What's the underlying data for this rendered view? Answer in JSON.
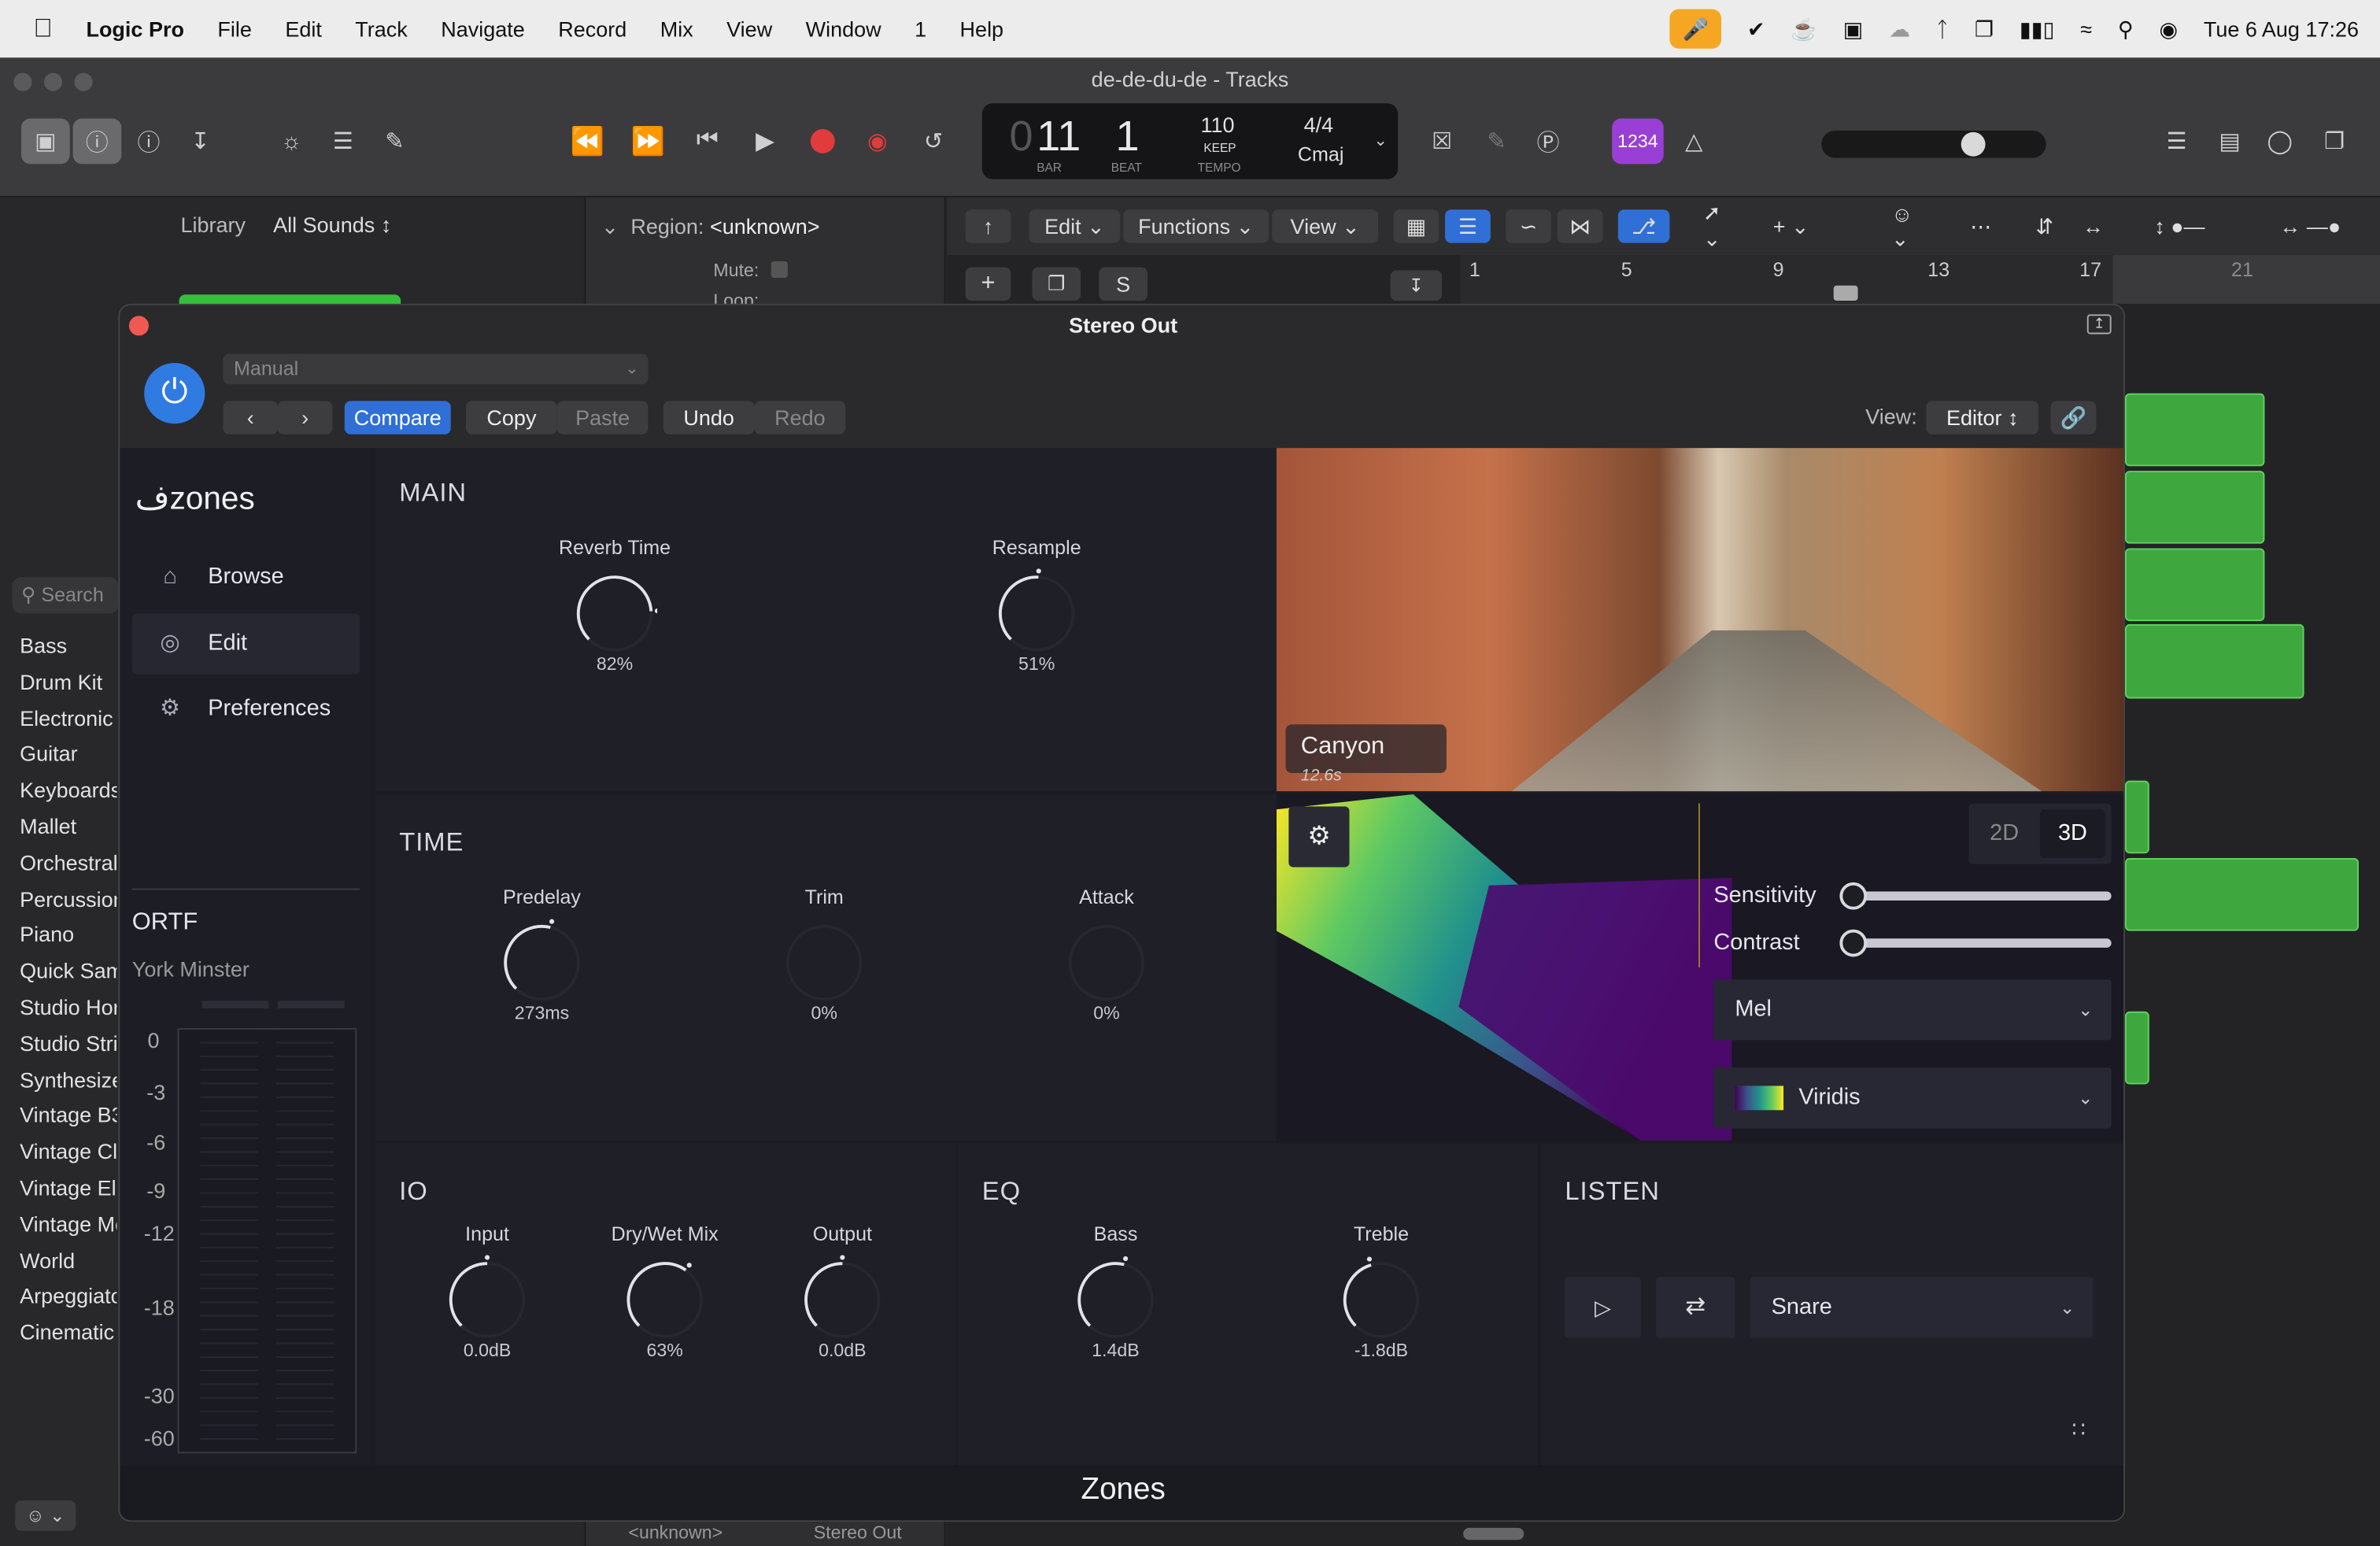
{
  "menubar": {
    "app": "Logic Pro",
    "items": [
      "File",
      "Edit",
      "Track",
      "Navigate",
      "Record",
      "Mix",
      "View",
      "Window",
      "1",
      "Help"
    ],
    "datetime": "Tue 6 Aug  17:26"
  },
  "window": {
    "title": "de-de-du-de - Tracks"
  },
  "lcd": {
    "bar": "11",
    "bar_prefix": "0",
    "bar_label": "BAR",
    "beat": "1",
    "beat_label": "BEAT",
    "tempo": "110",
    "tempo_mode": "KEEP",
    "tempo_label": "TEMPO",
    "signature": "4/4",
    "key": "Cmaj"
  },
  "count_in": "1234",
  "library": {
    "title": "Library",
    "sounds_dropdown": "All Sounds",
    "search_placeholder": "Search",
    "categories": [
      "Bass",
      "Drum Kit",
      "Electronic",
      "Guitar",
      "Keyboards",
      "Mallet",
      "Orchestral",
      "Percussion",
      "Piano",
      "Quick Sampler",
      "Studio Horns",
      "Studio Strings",
      "Synthesizer",
      "Vintage B3",
      "Vintage Clav",
      "Vintage Electric Piano",
      "Vintage Mellotron",
      "World",
      "Arpeggiator",
      "Cinematic"
    ]
  },
  "region": {
    "label": "Region:",
    "name": "<unknown>",
    "mute_label": "Mute:",
    "loop_label": "Loop:"
  },
  "tracks_toolbar": {
    "edit": "Edit",
    "functions": "Functions",
    "view": "View",
    "solo": "S"
  },
  "ruler": {
    "marks": [
      "1",
      "5",
      "9",
      "13",
      "17",
      "21"
    ]
  },
  "bottom_strip": {
    "left": "<unknown>",
    "right": "Stereo Out"
  },
  "plugin": {
    "title": "Stereo Out",
    "preset": "Manual",
    "compare": "Compare",
    "copy": "Copy",
    "paste": "Paste",
    "undo": "Undo",
    "redo": "Redo",
    "view_label": "View:",
    "view_value": "Editor",
    "footer": "Zones",
    "brand": "zones",
    "nav": [
      {
        "label": "Browse",
        "icon": "home-icon"
      },
      {
        "label": "Edit",
        "icon": "target-icon"
      },
      {
        "label": "Preferences",
        "icon": "gear-icon"
      }
    ],
    "ir": {
      "format": "ORTF",
      "name": "York Minster"
    },
    "meter_scale": [
      "0",
      "-3",
      "-6",
      "-9",
      "-12",
      "-18",
      "-30",
      "-60"
    ],
    "main": {
      "title": "MAIN",
      "reverb_time": {
        "label": "Reverb Time",
        "value": "82%",
        "level": 0.82
      },
      "resample": {
        "label": "Resample",
        "value": "51%",
        "level": 0.51
      }
    },
    "time": {
      "title": "TIME",
      "predelay": {
        "label": "Predelay",
        "value": "273ms",
        "level": 0.55
      },
      "trim": {
        "label": "Trim",
        "value": "0%",
        "level": 0
      },
      "attack": {
        "label": "Attack",
        "value": "0%",
        "level": 0
      }
    },
    "io": {
      "title": "IO",
      "input": {
        "label": "Input",
        "value": "0.0dB",
        "level": 0.5
      },
      "drywet": {
        "label": "Dry/Wet Mix",
        "value": "63%",
        "level": 0.63
      },
      "output": {
        "label": "Output",
        "value": "0.0dB",
        "level": 0.5
      }
    },
    "eq": {
      "title": "EQ",
      "bass": {
        "label": "Bass",
        "value": "1.4dB",
        "level": 0.55
      },
      "treble": {
        "label": "Treble",
        "value": "-1.8dB",
        "level": 0.44
      }
    },
    "listen": {
      "title": "LISTEN",
      "sample": "Snare"
    },
    "image": {
      "name": "Canyon",
      "duration": "12.6s"
    },
    "spectrogram": {
      "mode_2d": "2D",
      "mode_3d": "3D",
      "sensitivity_label": "Sensitivity",
      "sensitivity": 0,
      "contrast_label": "Contrast",
      "contrast": 0,
      "scale": "Mel",
      "colormap": "Viridis"
    }
  }
}
